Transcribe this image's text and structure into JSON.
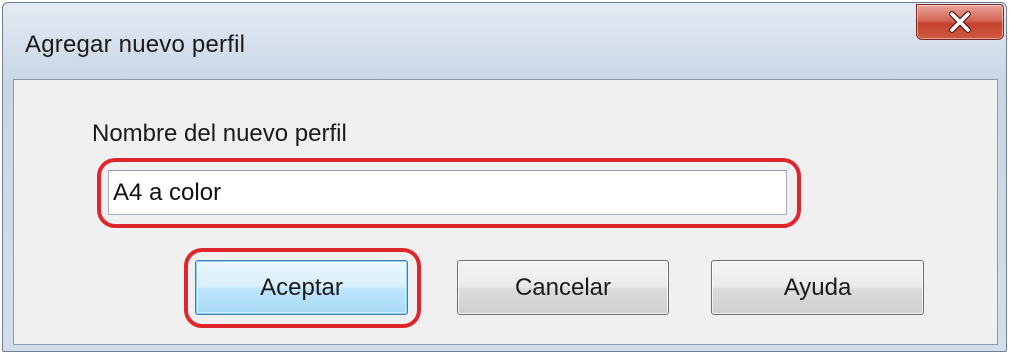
{
  "dialog": {
    "title": "Agregar nuevo perfil",
    "close_icon": "close-icon",
    "close_color": "#c3412f"
  },
  "form": {
    "label": "Nombre del nuevo perfil",
    "input_value": "A4 a color",
    "highlight_color": "#e0262d"
  },
  "buttons": {
    "ok_label": "Aceptar",
    "cancel_label": "Cancelar",
    "help_label": "Ayuda"
  }
}
